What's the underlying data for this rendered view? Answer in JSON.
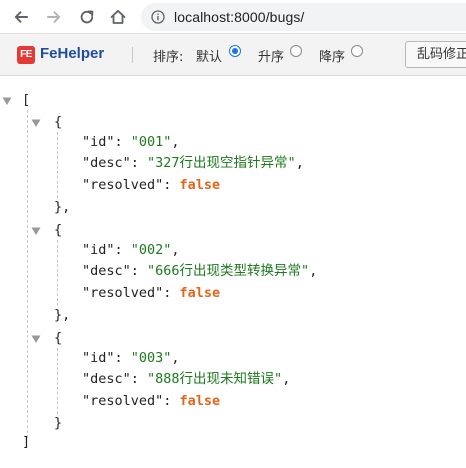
{
  "browser": {
    "url": "localhost:8000/bugs/"
  },
  "fehelper": {
    "brand": "FeHelper",
    "logo_text": "FE",
    "sort_label": "排序:",
    "sort_options": [
      "默认",
      "升序",
      "降序"
    ],
    "selected_sort": "默认",
    "fix_button": "乱码修正"
  },
  "json": {
    "open_bracket": "[",
    "close_bracket": "]",
    "items": [
      {
        "id": "\"001\"",
        "desc": "\"327行出现空指针异常\"",
        "resolved": "false"
      },
      {
        "id": "\"002\"",
        "desc": "\"666行出现类型转换异常\"",
        "resolved": "false"
      },
      {
        "id": "\"003\"",
        "desc": "\"888行出现未知错误\"",
        "resolved": "false"
      }
    ],
    "keys": {
      "id": "\"id\"",
      "desc": "\"desc\"",
      "resolved": "\"resolved\""
    }
  }
}
